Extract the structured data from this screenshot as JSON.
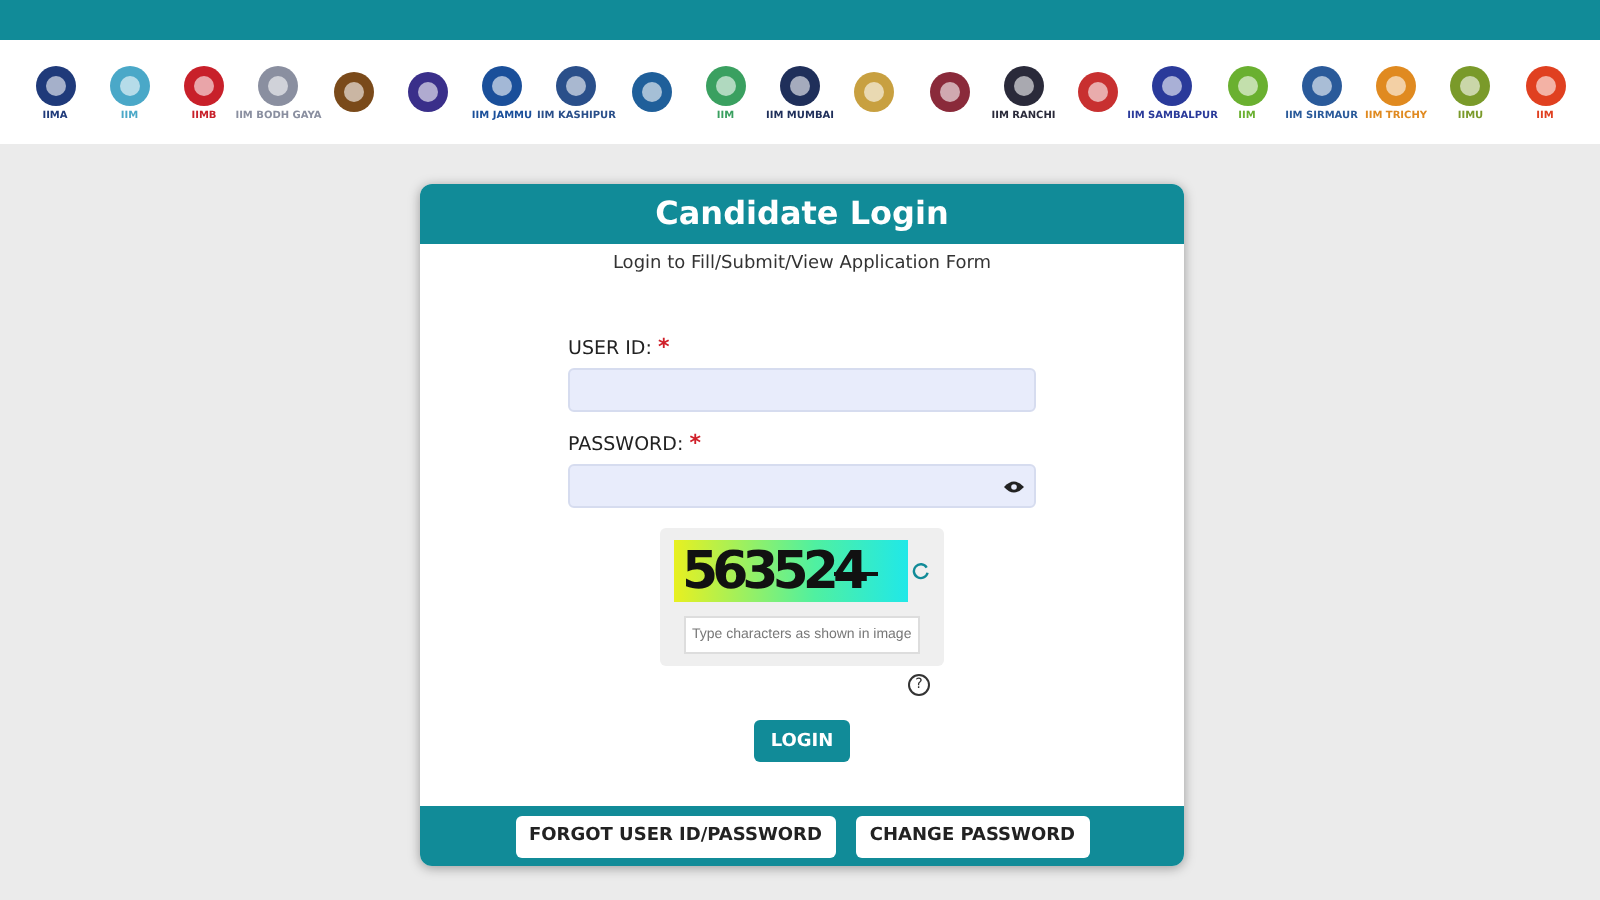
{
  "logos": [
    {
      "label": "IIMA",
      "color": "#1f3a7a"
    },
    {
      "label": "IIM",
      "color": "#4aa8c8"
    },
    {
      "label": "IIMB",
      "color": "#c8202a"
    },
    {
      "label": "IIM BODH GAYA",
      "color": "#8a8fa0"
    },
    {
      "color": "#7a4a1a"
    },
    {
      "color": "#3a2f8a"
    },
    {
      "label": "IIM JAMMU",
      "color": "#1a4f9a"
    },
    {
      "label": "IIM KASHIPUR",
      "color": "#2a4f8a"
    },
    {
      "color": "#1f5f9a"
    },
    {
      "label": "IIM",
      "color": "#3aa060"
    },
    {
      "label": "IIM MUMBAI",
      "color": "#1f2f5a"
    },
    {
      "color": "#c8a040"
    },
    {
      "color": "#8a2a3a"
    },
    {
      "label": "IIM RANCHI",
      "color": "#2a2a3a"
    },
    {
      "color": "#c83030"
    },
    {
      "label": "IIM SAMBALPUR",
      "color": "#2a3a9a"
    },
    {
      "label": "IIM",
      "color": "#6ab030"
    },
    {
      "label": "IIM SIRMAUR",
      "color": "#2a5a9a"
    },
    {
      "label": "IIM TRICHY",
      "color": "#e08a20"
    },
    {
      "label": "IIMU",
      "color": "#7a9a2a"
    },
    {
      "label": "IIM",
      "color": "#e04020"
    }
  ],
  "card": {
    "title": "Candidate Login",
    "subtitle": "Login to Fill/Submit/View Application Form",
    "fields": [
      {
        "label": "USER ID:",
        "required_mark": "*",
        "kind": "text"
      },
      {
        "label": "PASSWORD:",
        "required_mark": "*",
        "kind": "password"
      }
    ],
    "captcha": {
      "code": "563524",
      "placeholder": "Type characters as shown in image",
      "help": "?"
    },
    "login_button": "LOGIN",
    "footer_buttons": [
      "FORGOT USER ID/PASSWORD",
      "CHANGE PASSWORD"
    ]
  }
}
